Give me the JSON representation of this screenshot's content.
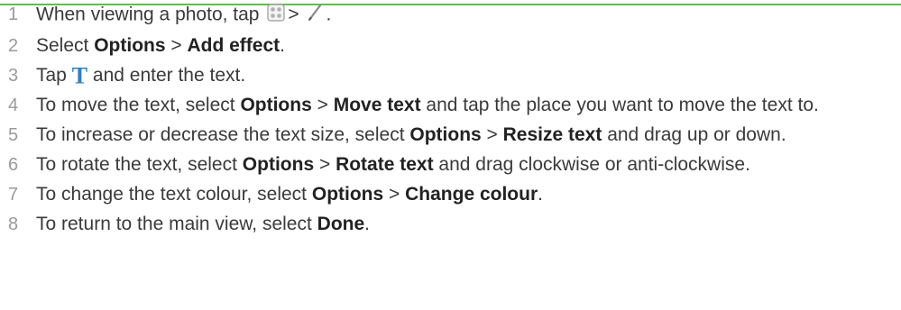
{
  "colors": {
    "accent": "#5cc04a",
    "number": "#9a9a9a",
    "text": "#3a3a3a"
  },
  "steps": [
    {
      "num": "1",
      "t1": "When viewing a photo, tap",
      "icon1": "grid-menu-icon",
      "t2": ">",
      "icon2": "edit-pencil-icon",
      "t3": "."
    },
    {
      "num": "2",
      "t1": "Select ",
      "b1": "Options",
      "t2": " > ",
      "b2": "Add effect",
      "t3": "."
    },
    {
      "num": "3",
      "t1": "Tap",
      "icon": "text-T-icon",
      "t2": "and enter the text."
    },
    {
      "num": "4",
      "t1": "To move the text, select ",
      "b1": "Options",
      "t2": " > ",
      "b2": "Move text",
      "t3": " and tap the place you want to move the text to."
    },
    {
      "num": "5",
      "t1": "To increase or decrease the text size, select ",
      "b1": "Options",
      "t2": " > ",
      "b2": "Resize text",
      "t3": " and drag up or down."
    },
    {
      "num": "6",
      "t1": "To rotate the text, select ",
      "b1": "Options",
      "t2": " > ",
      "b2": "Rotate text",
      "t3": " and drag clockwise or anti-clockwise."
    },
    {
      "num": "7",
      "t1": "To change the text colour, select ",
      "b1": "Options",
      "t2": " > ",
      "b2": "Change colour",
      "t3": "."
    },
    {
      "num": "8",
      "t1": "To return to the main view, select ",
      "b1": "Done",
      "t3": "."
    }
  ]
}
